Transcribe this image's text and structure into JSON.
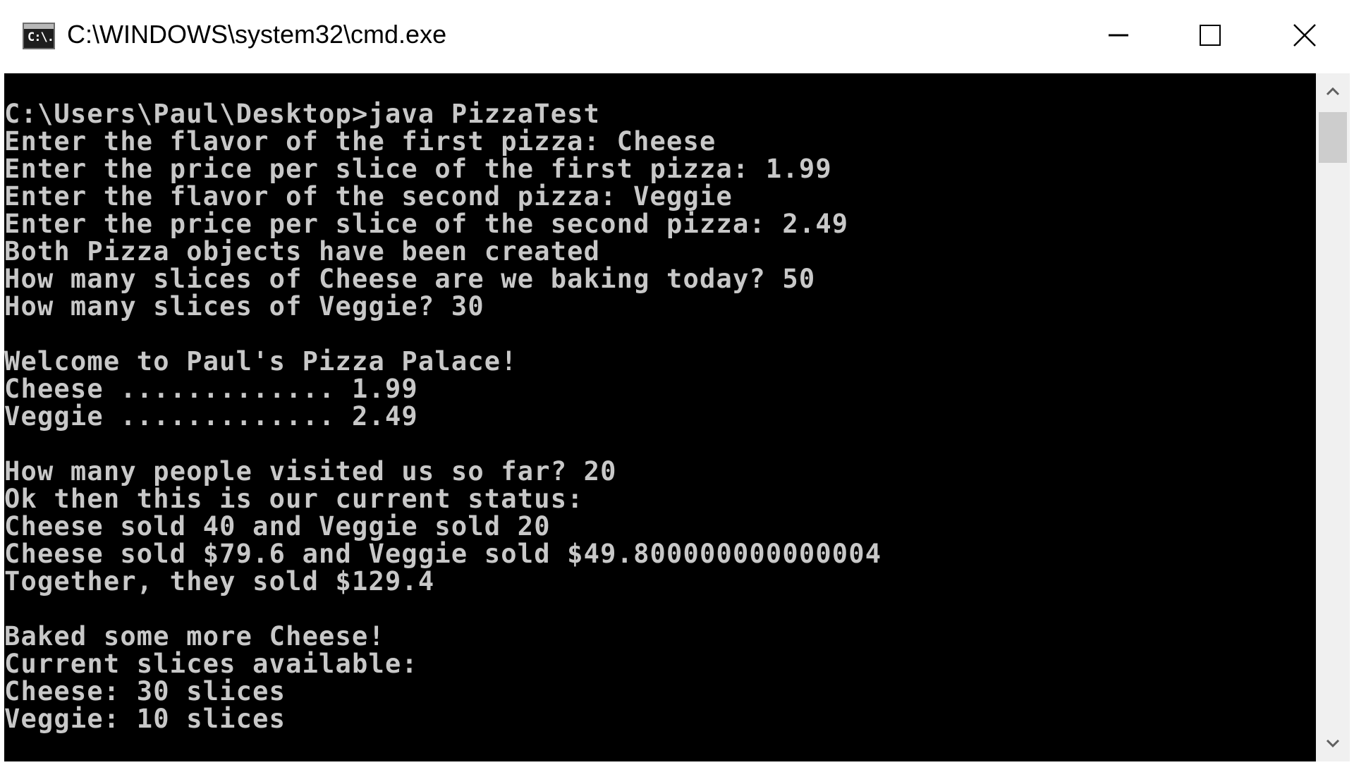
{
  "window": {
    "title": "C:\\WINDOWS\\system32\\cmd.exe",
    "icon_text": "C:\\.",
    "icon": "cmd-console-icon",
    "controls": [
      "minimize-icon",
      "maximize-icon",
      "close-icon"
    ]
  },
  "console": {
    "background": "#000000",
    "foreground": "#c8c8c8",
    "text": "C:\\Users\\Paul\\Desktop>java PizzaTest\nEnter the flavor of the first pizza: Cheese\nEnter the price per slice of the first pizza: 1.99\nEnter the flavor of the second pizza: Veggie\nEnter the price per slice of the second pizza: 2.49\nBoth Pizza objects have been created\nHow many slices of Cheese are we baking today? 50\nHow many slices of Veggie? 30\n\nWelcome to Paul's Pizza Palace!\nCheese ............. 1.99\nVeggie ............. 2.49\n\nHow many people visited us so far? 20\nOk then this is our current status:\nCheese sold 40 and Veggie sold 20\nCheese sold $79.6 and Veggie sold $49.800000000000004\nTogether, they sold $129.4\n\nBaked some more Cheese!\nCurrent slices available:\nCheese: 30 slices\nVeggie: 10 slices"
  },
  "scrollbar": {
    "up": "chevron-up-icon",
    "down": "chevron-down-icon"
  }
}
